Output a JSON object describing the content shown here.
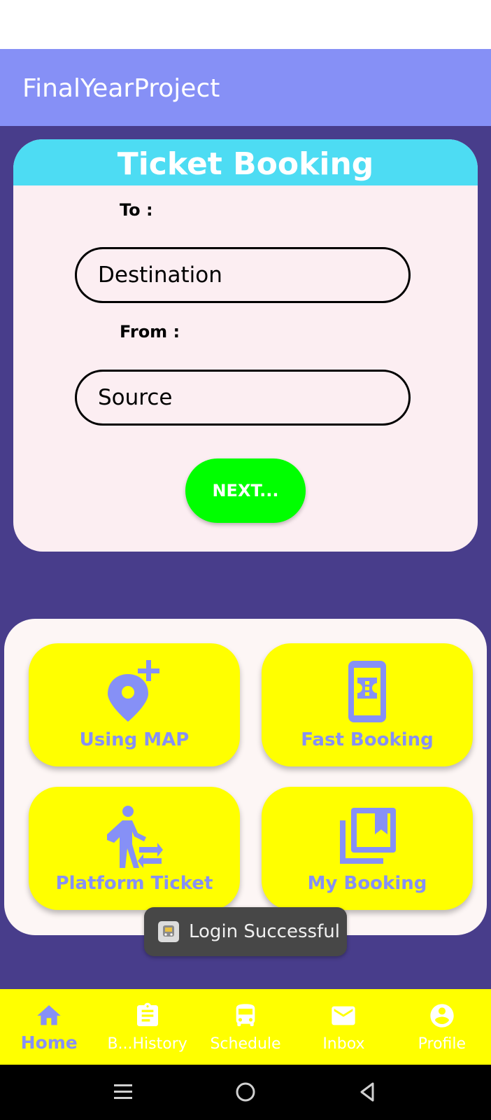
{
  "app": {
    "title": "FinalYearProject"
  },
  "booking": {
    "title": "Ticket Booking",
    "to_label": "To :",
    "destination_placeholder": "Destination",
    "from_label": "From :",
    "source_placeholder": "Source",
    "next_label": "NEXT..."
  },
  "actions": [
    {
      "label": "Using MAP",
      "icon": "add-location-icon"
    },
    {
      "label": "Fast Booking",
      "icon": "ticket-phone-icon"
    },
    {
      "label": "Platform Ticket",
      "icon": "pedestrian-transfer-icon"
    },
    {
      "label": "My Booking",
      "icon": "bookmarks-library-icon"
    }
  ],
  "toast": {
    "text": "Login Successful"
  },
  "bottom_nav": [
    {
      "label": "Home",
      "icon": "home-icon",
      "active": true
    },
    {
      "label": "B...History",
      "icon": "clipboard-icon",
      "active": false
    },
    {
      "label": "Schedule",
      "icon": "train-icon",
      "active": false
    },
    {
      "label": "Inbox",
      "icon": "mail-icon",
      "active": false
    },
    {
      "label": "Profile",
      "icon": "account-circle-icon",
      "active": false
    }
  ],
  "colors": {
    "app_bar": "#8690f6",
    "background": "#483d8b",
    "card_header": "#4ddcf3",
    "card": "#fceef2",
    "tile": "#ffff00",
    "next_button": "#00ff00",
    "accent": "#8690f6"
  }
}
